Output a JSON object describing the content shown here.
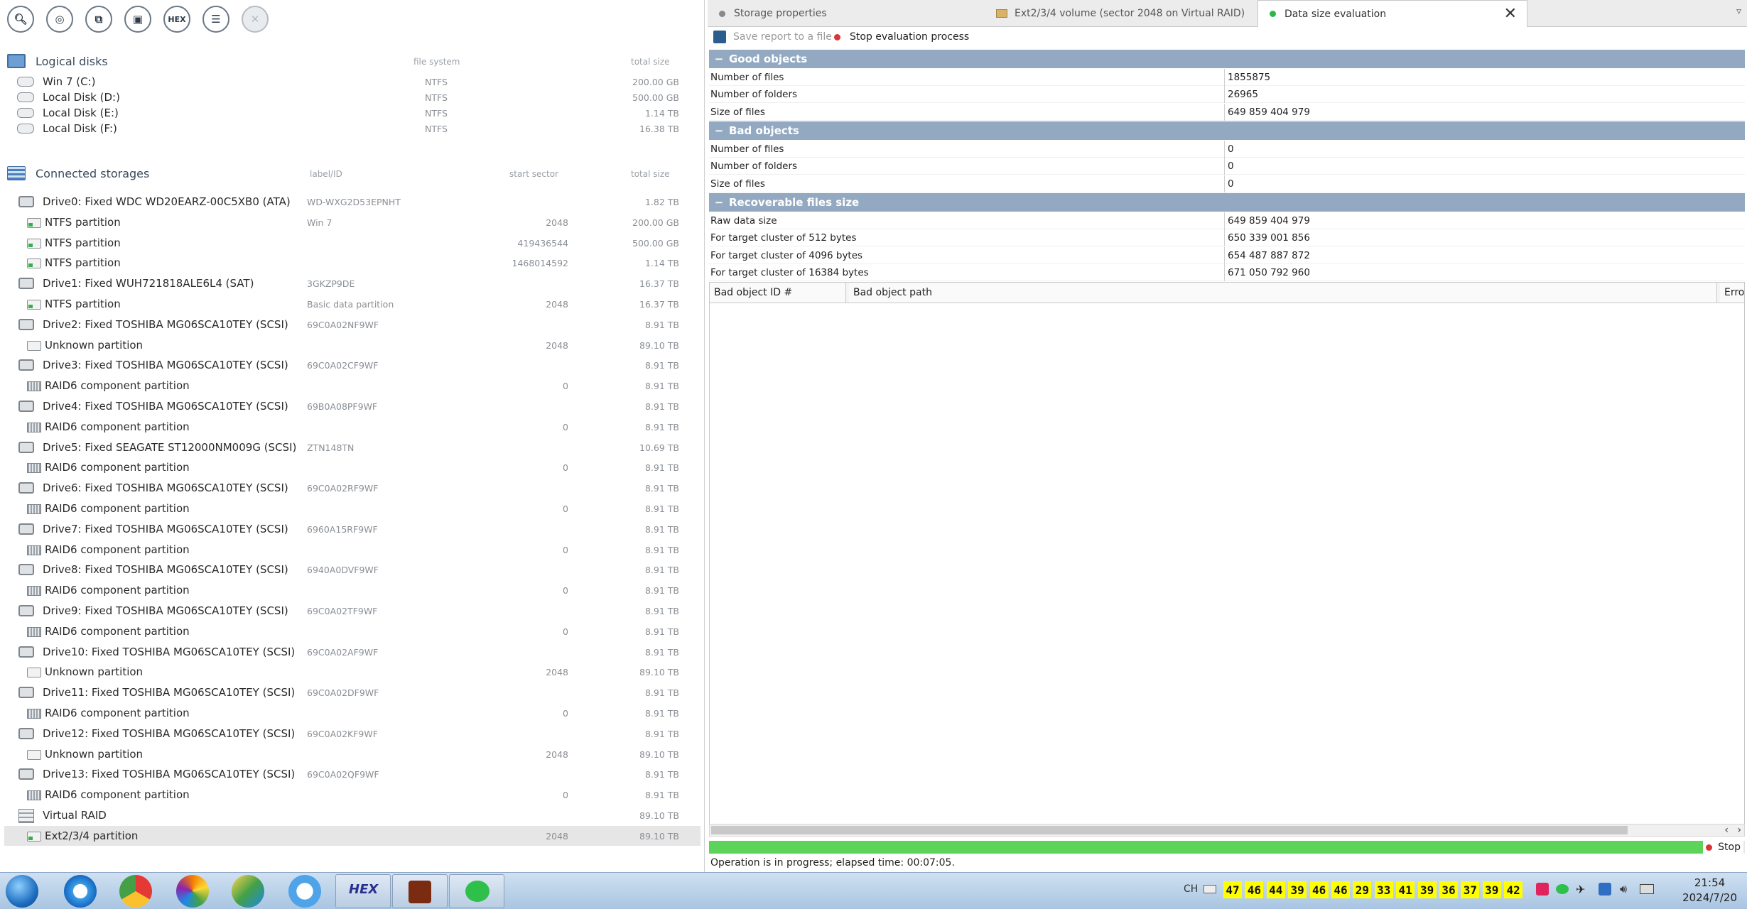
{
  "toolbar": {
    "icons": [
      "magnifier-icon",
      "scan-icon",
      "clone-icon",
      "lock-icon",
      "hex-icon",
      "list-icon",
      "close-icon"
    ],
    "hex_label": "HEX"
  },
  "logical_disks": {
    "title": "Logical disks",
    "col_fs": "file system",
    "col_size": "total size",
    "rows": [
      {
        "name": "Win 7 (C:)",
        "fs": "NTFS",
        "size": "200.00 GB"
      },
      {
        "name": "Local Disk (D:)",
        "fs": "NTFS",
        "size": "500.00 GB"
      },
      {
        "name": "Local Disk (E:)",
        "fs": "NTFS",
        "size": "1.14 TB"
      },
      {
        "name": "Local Disk (F:)",
        "fs": "NTFS",
        "size": "16.38 TB"
      }
    ]
  },
  "connected_storages": {
    "title": "Connected storages",
    "col_label": "label/ID",
    "col_start": "start sector",
    "col_size": "total size",
    "rows": [
      {
        "kind": "drive",
        "name": "Drive0: Fixed WDC WD20EARZ-00C5XB0 (ATA)",
        "label": "WD-WXG2D53EPNHT",
        "start": "",
        "size": "1.82 TB"
      },
      {
        "kind": "part-ok",
        "name": "NTFS partition",
        "label": "Win 7",
        "start": "2048",
        "size": "200.00 GB"
      },
      {
        "kind": "part-ok",
        "name": "NTFS partition",
        "label": "",
        "start": "419436544",
        "size": "500.00 GB"
      },
      {
        "kind": "part-ok",
        "name": "NTFS partition",
        "label": "",
        "start": "1468014592",
        "size": "1.14 TB"
      },
      {
        "kind": "drive",
        "name": "Drive1: Fixed WUH721818ALE6L4 (SAT)",
        "label": "3GKZP9DE",
        "start": "",
        "size": "16.37 TB"
      },
      {
        "kind": "part-ok",
        "name": "NTFS partition",
        "label": "Basic data partition",
        "start": "2048",
        "size": "16.37 TB"
      },
      {
        "kind": "drive",
        "name": "Drive2: Fixed TOSHIBA MG06SCA10TEY (SCSI)",
        "label": "69C0A02NF9WF",
        "start": "",
        "size": "8.91 TB"
      },
      {
        "kind": "unknown",
        "name": "Unknown partition",
        "label": "",
        "start": "2048",
        "size": "89.10 TB"
      },
      {
        "kind": "drive",
        "name": "Drive3: Fixed TOSHIBA MG06SCA10TEY (SCSI)",
        "label": "69C0A02CF9WF",
        "start": "",
        "size": "8.91 TB"
      },
      {
        "kind": "raid",
        "name": "RAID6 component partition",
        "label": "",
        "start": "0",
        "size": "8.91 TB"
      },
      {
        "kind": "drive",
        "name": "Drive4: Fixed TOSHIBA MG06SCA10TEY (SCSI)",
        "label": "69B0A08PF9WF",
        "start": "",
        "size": "8.91 TB"
      },
      {
        "kind": "raid",
        "name": "RAID6 component partition",
        "label": "",
        "start": "0",
        "size": "8.91 TB"
      },
      {
        "kind": "drive",
        "name": "Drive5: Fixed SEAGATE ST12000NM009G (SCSI)",
        "label": "ZTN148TN",
        "start": "",
        "size": "10.69 TB"
      },
      {
        "kind": "raid",
        "name": "RAID6 component partition",
        "label": "",
        "start": "0",
        "size": "8.91 TB"
      },
      {
        "kind": "drive",
        "name": "Drive6: Fixed TOSHIBA MG06SCA10TEY (SCSI)",
        "label": "69C0A02RF9WF",
        "start": "",
        "size": "8.91 TB"
      },
      {
        "kind": "raid",
        "name": "RAID6 component partition",
        "label": "",
        "start": "0",
        "size": "8.91 TB"
      },
      {
        "kind": "drive",
        "name": "Drive7: Fixed TOSHIBA MG06SCA10TEY (SCSI)",
        "label": "6960A15RF9WF",
        "start": "",
        "size": "8.91 TB"
      },
      {
        "kind": "raid",
        "name": "RAID6 component partition",
        "label": "",
        "start": "0",
        "size": "8.91 TB"
      },
      {
        "kind": "drive",
        "name": "Drive8: Fixed TOSHIBA MG06SCA10TEY (SCSI)",
        "label": "6940A0DVF9WF",
        "start": "",
        "size": "8.91 TB"
      },
      {
        "kind": "raid",
        "name": "RAID6 component partition",
        "label": "",
        "start": "0",
        "size": "8.91 TB"
      },
      {
        "kind": "drive",
        "name": "Drive9: Fixed TOSHIBA MG06SCA10TEY (SCSI)",
        "label": "69C0A02TF9WF",
        "start": "",
        "size": "8.91 TB"
      },
      {
        "kind": "raid",
        "name": "RAID6 component partition",
        "label": "",
        "start": "0",
        "size": "8.91 TB"
      },
      {
        "kind": "drive",
        "name": "Drive10: Fixed TOSHIBA MG06SCA10TEY (SCSI)",
        "label": "69C0A02AF9WF",
        "start": "",
        "size": "8.91 TB"
      },
      {
        "kind": "unknown",
        "name": "Unknown partition",
        "label": "",
        "start": "2048",
        "size": "89.10 TB"
      },
      {
        "kind": "drive",
        "name": "Drive11: Fixed TOSHIBA MG06SCA10TEY (SCSI)",
        "label": "69C0A02DF9WF",
        "start": "",
        "size": "8.91 TB"
      },
      {
        "kind": "raid",
        "name": "RAID6 component partition",
        "label": "",
        "start": "0",
        "size": "8.91 TB"
      },
      {
        "kind": "drive",
        "name": "Drive12: Fixed TOSHIBA MG06SCA10TEY (SCSI)",
        "label": "69C0A02KF9WF",
        "start": "",
        "size": "8.91 TB"
      },
      {
        "kind": "unknown",
        "name": "Unknown partition",
        "label": "",
        "start": "2048",
        "size": "89.10 TB"
      },
      {
        "kind": "drive",
        "name": "Drive13: Fixed TOSHIBA MG06SCA10TEY (SCSI)",
        "label": "69C0A02QF9WF",
        "start": "",
        "size": "8.91 TB"
      },
      {
        "kind": "raid",
        "name": "RAID6 component partition",
        "label": "",
        "start": "0",
        "size": "8.91 TB"
      },
      {
        "kind": "vraid",
        "name": "Virtual RAID",
        "label": "",
        "start": "",
        "size": "89.10 TB"
      },
      {
        "kind": "part-ok",
        "name": "Ext2/3/4 partition",
        "label": "",
        "start": "2048",
        "size": "89.10 TB",
        "selected": true
      }
    ]
  },
  "tabs": [
    {
      "label": "Storage properties",
      "dot": "#888888",
      "active": false
    },
    {
      "label": "Ext2/3/4 volume (sector 2048 on Virtual RAID)",
      "dot": "folder",
      "active": false
    },
    {
      "label": "Data size evaluation",
      "dot": "#2fb64a",
      "active": true
    }
  ],
  "report_bar": {
    "save": "Save report to a file",
    "stop": "Stop evaluation process"
  },
  "good": {
    "title": "Good objects",
    "rows": [
      {
        "k": "Number of files",
        "v": "1855875"
      },
      {
        "k": "Number of folders",
        "v": "26965"
      },
      {
        "k": "Size of files",
        "v": "649 859 404 979"
      }
    ]
  },
  "bad": {
    "title": "Bad objects",
    "rows": [
      {
        "k": "Number of files",
        "v": "0"
      },
      {
        "k": "Number of folders",
        "v": "0"
      },
      {
        "k": "Size of files",
        "v": "0"
      }
    ]
  },
  "recoverable": {
    "title": "Recoverable files size",
    "rows": [
      {
        "k": "Raw data size",
        "v": "649 859 404 979"
      },
      {
        "k": "For target cluster of 512 bytes",
        "v": "650 339 001 856"
      },
      {
        "k": "For target cluster of 4096 bytes",
        "v": "654 487 887 872"
      },
      {
        "k": "For target cluster of 16384 bytes",
        "v": "671 050 792 960"
      }
    ]
  },
  "bad_table": {
    "col1": "Bad object ID #",
    "col2": "Bad object path",
    "col3": "Erro"
  },
  "progress": {
    "fraction": 0.98,
    "stop": "Stop"
  },
  "status": "Operation is in progress; elapsed time: 00:07:05.",
  "taskbar": {
    "apps": [
      "start-orb-icon",
      "ie-icon",
      "chrome-icon",
      "browser-icon",
      "player-icon",
      "app-icon",
      "hex-app",
      "game-app",
      "wechat-app"
    ],
    "hex_label": "HEX",
    "ime": "CH",
    "tray_numbers": [
      "47",
      "46",
      "44",
      "39",
      "46",
      "46",
      "29",
      "33",
      "41",
      "39",
      "36",
      "37",
      "39",
      "42"
    ],
    "time": "21:54",
    "date": "2024/7/20"
  }
}
